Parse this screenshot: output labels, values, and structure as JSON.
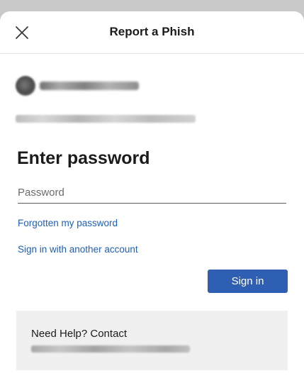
{
  "header": {
    "title": "Report a Phish",
    "close_icon": "close-icon"
  },
  "account": {
    "name_redacted": true,
    "email_redacted": true
  },
  "form": {
    "heading": "Enter password",
    "password_placeholder": "Password",
    "password_value": ""
  },
  "links": {
    "forgot": "Forgotten my password",
    "other_account": "Sign in with another account"
  },
  "actions": {
    "sign_in_label": "Sign in"
  },
  "help": {
    "text": "Need Help? Contact"
  },
  "colors": {
    "accent": "#2f5fb2",
    "link": "#1f5fb5",
    "help_background": "#f0f0f0"
  }
}
